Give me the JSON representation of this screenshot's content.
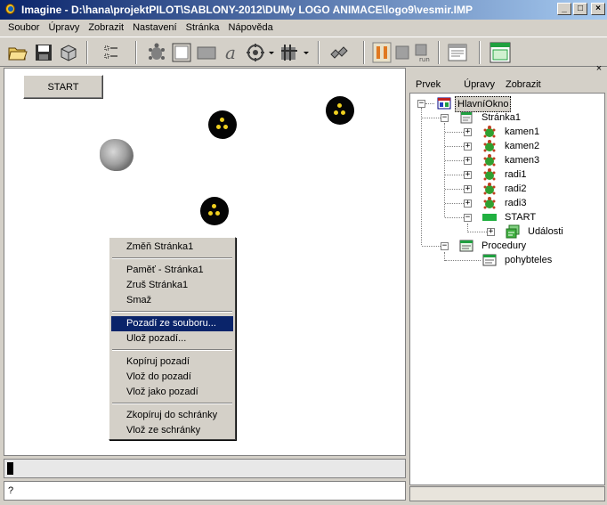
{
  "window": {
    "title": "Imagine - D:\\hana\\projektPILOT\\SABLONY-2012\\DUMy LOGO ANIMACE\\logo9\\vesmir.IMP",
    "buttons": [
      "_",
      "□",
      "×"
    ]
  },
  "menubar": [
    "Soubor",
    "Úpravy",
    "Zobrazit",
    "Nastavení",
    "Stránka",
    "Nápověda"
  ],
  "toolbar": {
    "icons": [
      "open-folder-icon",
      "save-disk-icon",
      "package-icon",
      "page-list-icon",
      "page-list-2-icon",
      "turtle-icon",
      "frame-icon",
      "rectangle-icon",
      "text-a-icon",
      "gear-dropdown-icon",
      "bitmap-dropdown-icon",
      "puzzle-icon",
      "pause-icon",
      "stop-icon",
      "run-icon",
      "window-icon",
      "main-window-icon"
    ],
    "run_label": "run"
  },
  "canvas": {
    "start_button": "START"
  },
  "context_menu": {
    "items": [
      "Změň Stránka1",
      "Paměť - Stránka1",
      "Zruš Stránka1",
      "Smaž",
      "Pozadí ze souboru...",
      "Ulož pozadí...",
      "Kopíruj pozadí",
      "Vlož do pozadí",
      "Vlož jako pozadí",
      "Zkopíruj do schránky",
      "Vlož ze schránky"
    ],
    "highlighted": "Pozadí ze souboru..."
  },
  "command_line": {
    "prompt": "?"
  },
  "right_panel": {
    "close": "×",
    "menu": [
      "Prvek",
      "Úpravy",
      "Zobrazit"
    ],
    "tree": [
      {
        "label": "HlavníOkno",
        "expanded": true,
        "icon": "main-window-icon"
      },
      {
        "label": "Stránka1",
        "expanded": true,
        "icon": "page-icon"
      },
      {
        "label": "kamen1",
        "expanded": false,
        "icon": "turtle-icon"
      },
      {
        "label": "kamen2",
        "expanded": false,
        "icon": "turtle-icon"
      },
      {
        "label": "kamen3",
        "expanded": false,
        "icon": "turtle-icon"
      },
      {
        "label": "radi1",
        "expanded": false,
        "icon": "turtle-icon"
      },
      {
        "label": "radi2",
        "expanded": false,
        "icon": "turtle-icon"
      },
      {
        "label": "radi3",
        "expanded": false,
        "icon": "turtle-icon"
      },
      {
        "label": "START",
        "expanded": true,
        "icon": "button-icon"
      },
      {
        "label": "Události",
        "expanded": false,
        "icon": "events-icon"
      },
      {
        "label": "Procedury",
        "expanded": true,
        "icon": "procedures-icon"
      },
      {
        "label": "pohybteles",
        "expanded": null,
        "icon": "procedure-icon"
      }
    ]
  },
  "colors": {
    "title_gradient_start": "#0a246a",
    "title_gradient_end": "#a6caf0",
    "menu_highlight": "#0a246a",
    "face": "#d4d0c8",
    "radi_eyes": "#f0d020"
  }
}
